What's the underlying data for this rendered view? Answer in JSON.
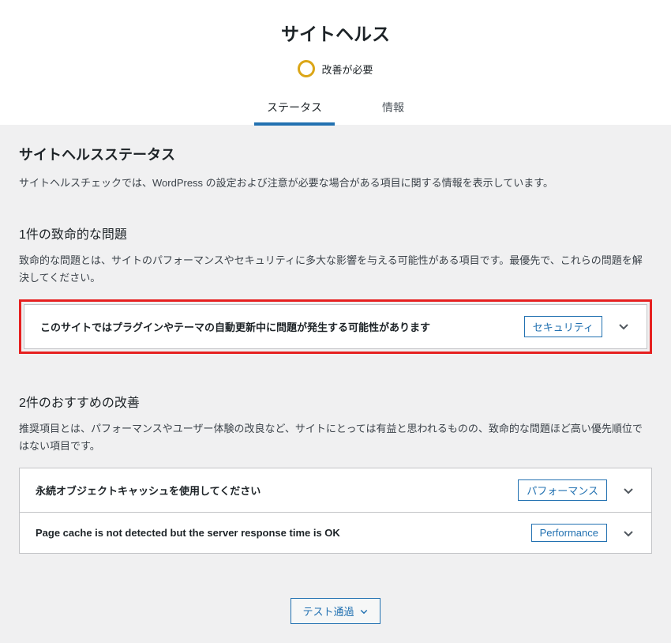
{
  "header": {
    "title": "サイトヘルス",
    "status_label": "改善が必要"
  },
  "tabs": {
    "status": "ステータス",
    "info": "情報"
  },
  "status_section": {
    "heading": "サイトヘルスステータス",
    "desc": "サイトヘルスチェックでは、WordPress の設定および注意が必要な場合がある項目に関する情報を表示しています。"
  },
  "critical": {
    "heading": "1件の致命的な問題",
    "desc": "致命的な問題とは、サイトのパフォーマンスやセキュリティに多大な影響を与える可能性がある項目です。最優先で、これらの問題を解決してください。",
    "items": [
      {
        "title": "このサイトではプラグインやテーマの自動更新中に問題が発生する可能性があります",
        "badge": "セキュリティ"
      }
    ]
  },
  "recommended": {
    "heading": "2件のおすすめの改善",
    "desc": "推奨項目とは、パフォーマンスやユーザー体験の改良など、サイトにとっては有益と思われるものの、致命的な問題ほど高い優先順位ではない項目です。",
    "items": [
      {
        "title": "永続オブジェクトキャッシュを使用してください",
        "badge": "パフォーマンス"
      },
      {
        "title": "Page cache is not detected but the server response time is OK",
        "badge": "Performance"
      }
    ]
  },
  "passed_button": "テスト通過"
}
